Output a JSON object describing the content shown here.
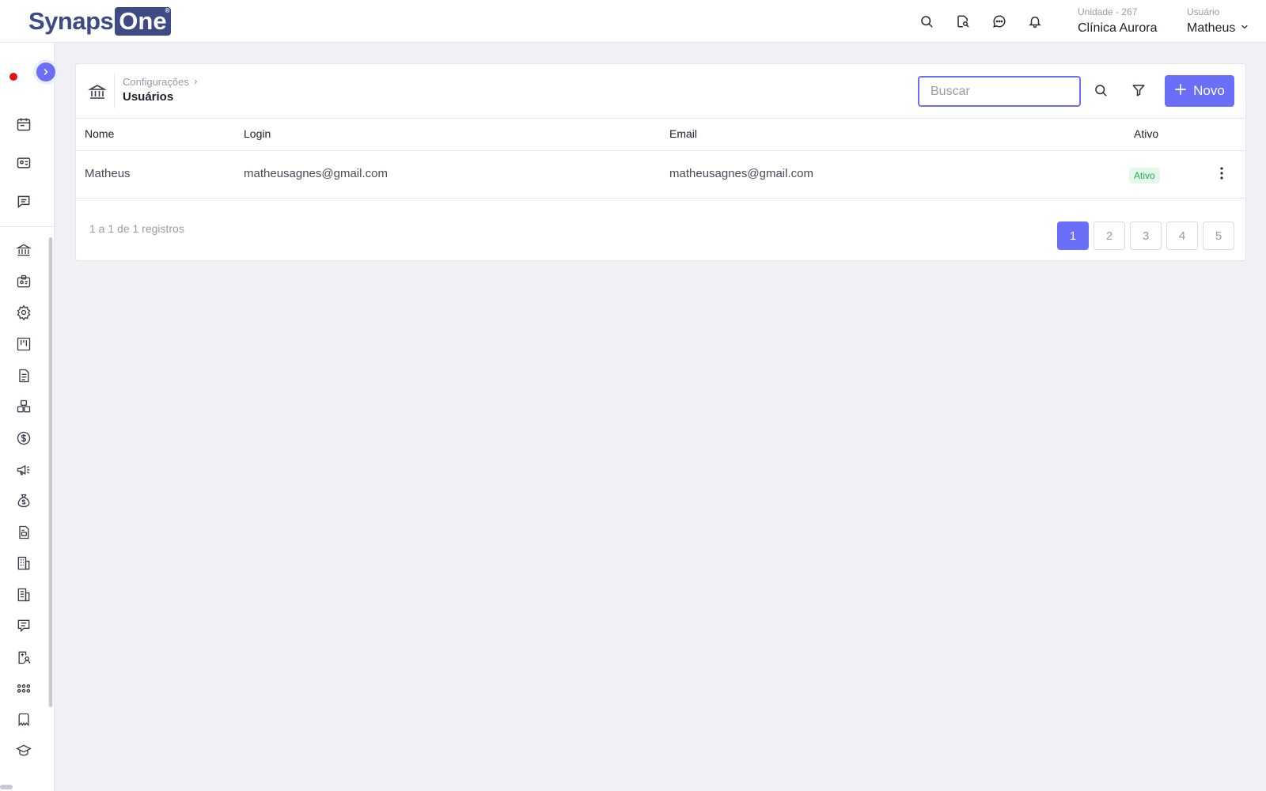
{
  "header": {
    "logo_part1": "Synaps",
    "logo_part2": "One",
    "logo_reg": "®",
    "unit_label": "Unidade - 267",
    "unit_name": "Clínica Aurora",
    "user_label": "Usuário",
    "user_name": "Matheus",
    "icons": [
      "search-icon",
      "document-search-icon",
      "chat-icon",
      "bell-icon",
      "chevron-down-icon"
    ]
  },
  "sidebar": {
    "top_icons": [
      "calendar-icon",
      "id-card-icon",
      "message-icon"
    ],
    "icons": [
      "bank-icon",
      "badge-icon",
      "gear-icon",
      "kanban-icon",
      "document-icon",
      "boxes-icon",
      "dollar-icon",
      "megaphone-icon",
      "money-bag-icon",
      "file-text-icon",
      "building-icon",
      "building-alt-icon",
      "comment-icon",
      "clipboard-user-icon",
      "dots-grid-icon",
      "tooth-icon",
      "graduation-cap-icon"
    ]
  },
  "page": {
    "breadcrumb": "Configurações",
    "title": "Usuários",
    "search_placeholder": "Buscar",
    "new_label": "Novo"
  },
  "table": {
    "columns": [
      "Nome",
      "Login",
      "Email",
      "Ativo"
    ],
    "rows": [
      {
        "nome": "Matheus",
        "login": "matheusagnes@gmail.com",
        "email": "matheusagnes@gmail.com",
        "ativo": "Ativo"
      }
    ]
  },
  "pagination": {
    "records_text": "1 a 1 de 1 registros",
    "pages": [
      "1",
      "2",
      "3",
      "4",
      "5"
    ],
    "current": "1"
  },
  "colors": {
    "accent": "#6b6ff7",
    "brand": "#3d4a86",
    "status_active_bg": "#e3f7ea",
    "status_active_text": "#27a857",
    "record_dot": "#e0141b"
  }
}
